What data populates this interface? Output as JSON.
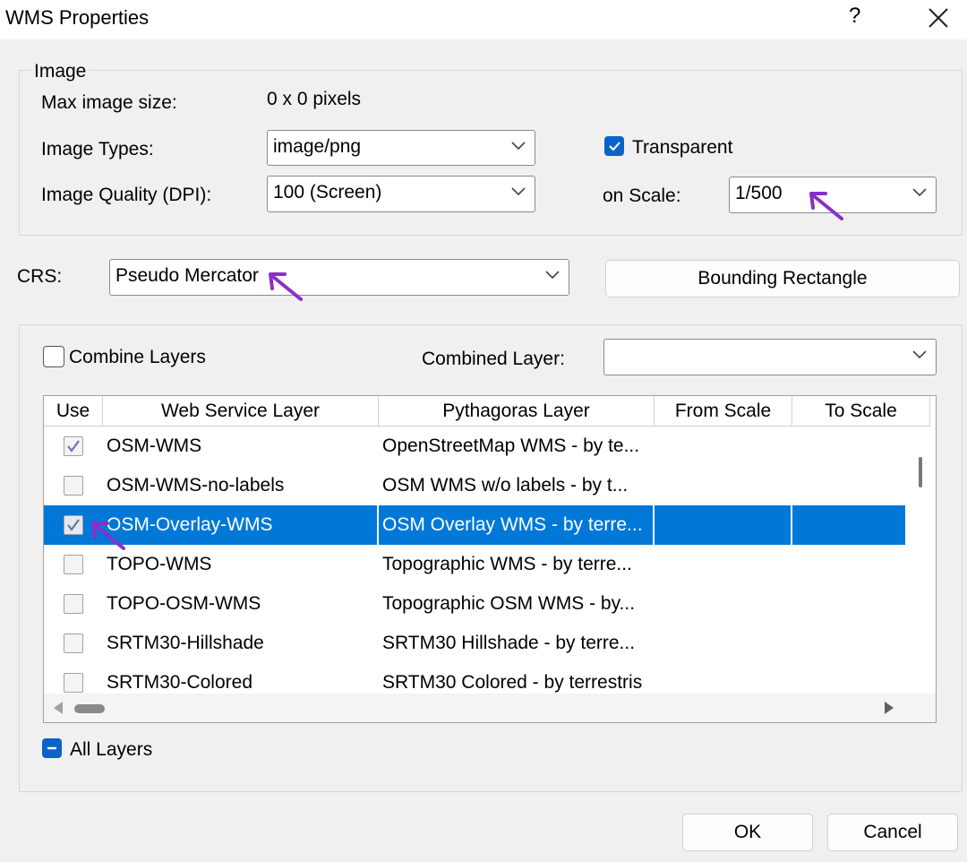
{
  "window": {
    "title": "WMS Properties",
    "help_label": "?"
  },
  "image_group": {
    "legend": "Image",
    "max_size_label": "Max image size:",
    "max_size_value": "0 x 0 pixels",
    "types_label": "Image Types:",
    "types_value": "image/png",
    "transparent_label": "Transparent",
    "transparent_checked": true,
    "quality_label": "Image Quality (DPI):",
    "quality_value": "100 (Screen)",
    "scale_label": "on Scale:",
    "scale_value": "1/500"
  },
  "crs": {
    "label": "CRS:",
    "value": "Pseudo Mercator",
    "bounding_button": "Bounding Rectangle"
  },
  "layers_group": {
    "combine_label": "Combine Layers",
    "combine_checked": false,
    "combined_layer_label": "Combined Layer:",
    "combined_layer_value": "",
    "columns": [
      "Use",
      "Web Service Layer",
      "Pythagoras Layer",
      "From Scale",
      "To Scale"
    ],
    "rows": [
      {
        "use": true,
        "web": "OSM-WMS",
        "pyth": "OpenStreetMap WMS - by te...",
        "selected": false
      },
      {
        "use": false,
        "web": "OSM-WMS-no-labels",
        "pyth": "OSM WMS w/o labels - by t...",
        "selected": false
      },
      {
        "use": true,
        "web": "OSM-Overlay-WMS",
        "pyth": "OSM Overlay WMS - by terre...",
        "selected": true
      },
      {
        "use": false,
        "web": "TOPO-WMS",
        "pyth": "Topographic WMS - by terre...",
        "selected": false
      },
      {
        "use": false,
        "web": "TOPO-OSM-WMS",
        "pyth": "Topographic OSM WMS - by...",
        "selected": false
      },
      {
        "use": false,
        "web": "SRTM30-Hillshade",
        "pyth": "SRTM30 Hillshade - by terre...",
        "selected": false
      },
      {
        "use": false,
        "web": "SRTM30-Colored",
        "pyth": "SRTM30 Colored - by terrestris",
        "selected": false
      }
    ],
    "all_layers_label": "All Layers"
  },
  "buttons": {
    "ok": "OK",
    "cancel": "Cancel"
  },
  "colors": {
    "accent": "#0a63c8",
    "selection": "#0078d7",
    "annotation_arrow": "#8a2fc8"
  }
}
